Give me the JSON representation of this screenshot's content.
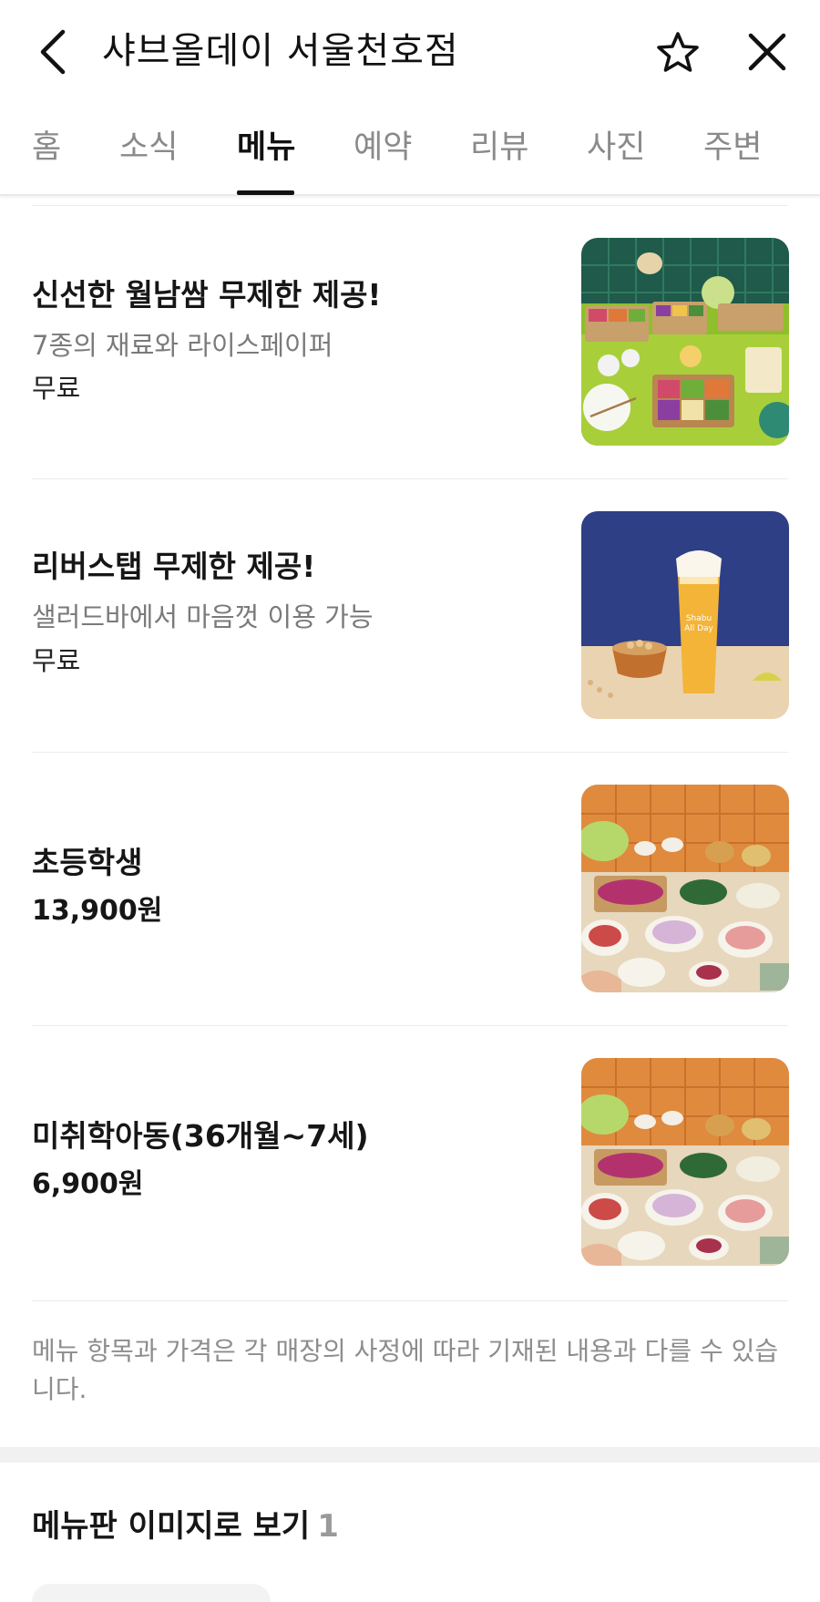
{
  "header": {
    "title": "샤브올데이 서울천호점",
    "back_icon": "chevron-left-icon",
    "favorite_icon": "star-outline-icon",
    "close_icon": "close-icon"
  },
  "tabs": [
    {
      "label": "홈",
      "active": false
    },
    {
      "label": "소식",
      "active": false
    },
    {
      "label": "메뉴",
      "active": true
    },
    {
      "label": "예약",
      "active": false
    },
    {
      "label": "리뷰",
      "active": false
    },
    {
      "label": "사진",
      "active": false
    },
    {
      "label": "주변",
      "active": false
    }
  ],
  "menu_items": [
    {
      "name": "신선한 월남쌈 무제한 제공!",
      "description": "7종의 재료와 라이스페이퍼",
      "price": "무료"
    },
    {
      "name": "리버스탭 무제한 제공!",
      "description": "샐러드바에서 마음껏 이용 가능",
      "price": "무료"
    },
    {
      "name": "초등학생",
      "description": "",
      "price": "13,900원"
    },
    {
      "name": "미취학아동(36개월~7세)",
      "description": "",
      "price": "6,900원"
    }
  ],
  "notice": "메뉴 항목과 가격은 각 매장의 사정에 따라 기재된 내용과 다를 수 있습니다.",
  "menu_board": {
    "title": "메뉴판 이미지로 보기",
    "count": "1"
  },
  "colors": {
    "text_primary": "#161616",
    "text_secondary": "#7a7a7a",
    "divider": "#ececec",
    "section_bg": "#f1f1f1"
  }
}
